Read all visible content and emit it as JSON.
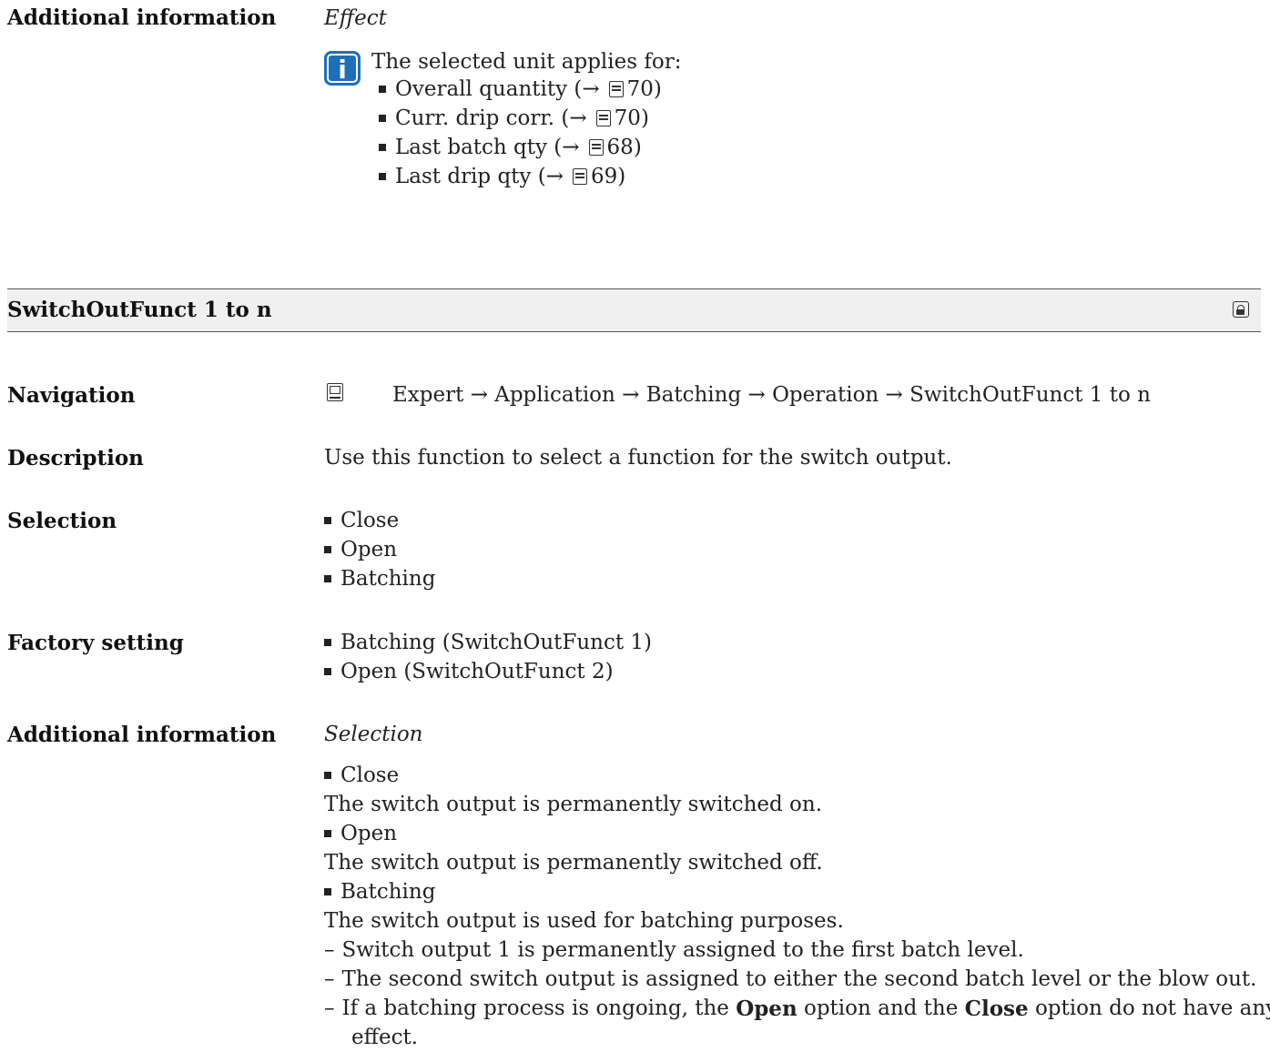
{
  "top_section": {
    "label": "Additional information",
    "effect_heading": "Effect",
    "note_text": "The selected unit applies for:",
    "items": [
      {
        "text": "Overall quantity (→",
        "page": "70)"
      },
      {
        "text": "Curr. drip corr. (→",
        "page": "70)"
      },
      {
        "text": "Last batch qty (→",
        "page": "68)"
      },
      {
        "text": "Last drip qty (→",
        "page": "69)"
      }
    ]
  },
  "parameter": {
    "title": "SwitchOutFunct 1 to n",
    "navigation_label": "Navigation",
    "navigation_path": "Expert → Application → Batching → Operation → SwitchOutFunct 1 to n",
    "description_label": "Description",
    "description_text": "Use this function to select a function for the switch output.",
    "selection_label": "Selection",
    "selection_options": [
      "Close",
      "Open",
      "Batching"
    ],
    "factory_label": "Factory setting",
    "factory_values": [
      "Batching (SwitchOutFunct 1)",
      "Open (SwitchOutFunct 2)"
    ],
    "additional_label": "Additional information",
    "additional_heading": "Selection",
    "additional_items": [
      {
        "name": "Close",
        "detail": "The switch output is permanently switched on."
      },
      {
        "name": "Open",
        "detail": "The switch output is permanently switched off."
      },
      {
        "name": "Batching",
        "detail": "The switch output is used for batching purposes."
      }
    ],
    "batching_notes": [
      "Switch output 1 is permanently assigned to the first batch level.",
      "The second switch output is assigned to either the second batch level or the blow out."
    ],
    "last_note": {
      "part1": "If a batching process is ongoing, the",
      "open_word": "Open",
      "part2": "option and the",
      "close_word": "Close",
      "part3": "option do not have any",
      "line2": "effect."
    }
  }
}
